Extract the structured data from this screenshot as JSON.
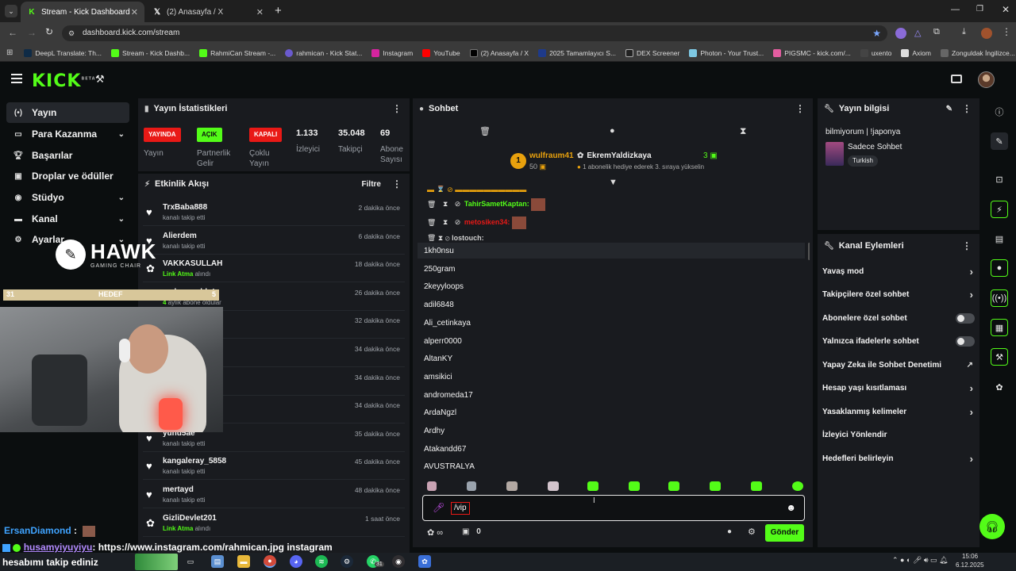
{
  "browser": {
    "tabs": [
      {
        "label": "Stream - Kick Dashboard",
        "active": true
      },
      {
        "label": "(2) Anasayfa / X",
        "active": false
      }
    ],
    "url": "dashboard.kick.com/stream",
    "bookmarks": [
      "DeepL Translate: Th...",
      "Stream - Kick Dashb...",
      "RahmiCan Stream -...",
      "rahmican - Kick Stat...",
      "Instagram",
      "YouTube",
      "(2) Anasayfa / X",
      "2025 Tamamlayıcı S...",
      "DEX Screener",
      "Photon - Your Trust...",
      "PIGSMC - kick.com/...",
      "uxento",
      "Axiom",
      "Zonguldak İngilizce..."
    ]
  },
  "kick": {
    "logo": "KICK",
    "beta": "BETA"
  },
  "sidebar": {
    "items": [
      {
        "label": "Yayın",
        "icon": "broadcast-icon",
        "chev": false
      },
      {
        "label": "Para Kazanma",
        "icon": "money-icon",
        "chev": true
      },
      {
        "label": "Başarılar",
        "icon": "trophy-icon",
        "chev": false
      },
      {
        "label": "Droplar ve ödüller",
        "icon": "gift-icon",
        "chev": false
      },
      {
        "label": "Stüdyo",
        "icon": "studio-icon",
        "chev": true
      },
      {
        "label": "Kanal",
        "icon": "channel-icon",
        "chev": true
      },
      {
        "label": "Ayarlar",
        "icon": "gear-icon",
        "chev": true
      }
    ]
  },
  "stats": {
    "title": "Yayın İstatistikleri",
    "badges": [
      {
        "text": "YAYINDA",
        "label": "Yayın",
        "bg": "#e91916",
        "fg": "#ffffff"
      },
      {
        "text": "AÇIK",
        "label": "Partnerlik Gelir",
        "bg": "#53fc18",
        "fg": "#0b0e0f"
      },
      {
        "text": "KAPALI",
        "label": "Çoklu Yayın",
        "bg": "#e91916",
        "fg": "#ffffff"
      }
    ],
    "numbers": [
      {
        "value": "1.133",
        "label": "İzleyici"
      },
      {
        "value": "35.048",
        "label": "Takipçi"
      },
      {
        "value": "69",
        "label": "Abone Sayısı"
      }
    ]
  },
  "activity": {
    "title": "Etkinlik Akışı",
    "filter": "Filtre",
    "items": [
      {
        "name": "TrxBaba888",
        "sub": "kanalı takip etti",
        "time": "2 dakika önce",
        "type": "follow"
      },
      {
        "name": "Alierdem",
        "sub": "kanalı takip etti",
        "time": "6 dakika önce",
        "type": "follow"
      },
      {
        "name": "VAKKASULLAH",
        "sub_green": "Link Atma",
        "sub": " alındı",
        "time": "18 dakika önce",
        "type": "reward"
      },
      {
        "name": "n abone oldu!",
        "sub_green": "4",
        "sub": " aylık abone oldular",
        "time": "26 dakika önce",
        "type": "sub"
      },
      {
        "name": "",
        "sub": "",
        "time": "32 dakika önce",
        "type": "hidden"
      },
      {
        "name": "",
        "sub": "",
        "time": "34 dakika önce",
        "type": "hidden"
      },
      {
        "name": "",
        "sub": "",
        "time": "34 dakika önce",
        "type": "hidden"
      },
      {
        "name": "",
        "sub": "",
        "time": "34 dakika önce",
        "type": "hidden"
      },
      {
        "name": "yunu5ae",
        "sub": "kanalı takip etti",
        "time": "35 dakika önce",
        "type": "follow"
      },
      {
        "name": "kangaleray_5858",
        "sub": "kanalı takip etti",
        "time": "45 dakika önce",
        "type": "follow"
      },
      {
        "name": "mertayd",
        "sub": "kanalı takip etti",
        "time": "48 dakika önce",
        "type": "follow"
      },
      {
        "name": "GizliDevlet201",
        "sub_green": "Link Atma",
        "sub": " alındı",
        "time": "1 saat önce",
        "type": "reward"
      }
    ]
  },
  "overlay": {
    "brand": "HAWK",
    "brand_sub": "GAMING CHAIR",
    "goal_left": "31",
    "goal_label": "HEDEF",
    "goal_right": "5",
    "chat_line1_user": "ErsanDiamond",
    "chat_line2_user": "husamyiyuyiyu",
    "chat_line2_text": ": https://www.instagram.com/rahmican.jpg instagram",
    "chat_line3": "hesabımı takip ediniz"
  },
  "chat": {
    "title": "Sohbet",
    "pinned_user": "wulfraum41",
    "pinned_count": "50",
    "pinned_rank": "1",
    "gifter": "EkremYaldizkaya",
    "gift_count": "3",
    "gift_text": "1 abonelik hediye ederek 3. sıraya yükselin",
    "messages": [
      {
        "user": "TahirSametKaptan:",
        "color": "#53fc18"
      },
      {
        "user": "metosiken34:",
        "color": "#e91916"
      },
      {
        "user": "lostouch:",
        "color": "#cfcfcf"
      }
    ],
    "suggestions": [
      "1kh0nsu",
      "250gram",
      "2keyyloops",
      "adil6848",
      "Ali_cetinkaya",
      "alperr0000",
      "AltanKY",
      "amsikici",
      "andromeda17",
      "ArdaNgzl",
      "Ardhy",
      "Atakandd67",
      "AVUSTRALYA"
    ],
    "input_value": "/vip",
    "send_label": "Gönder",
    "footer_count": "0"
  },
  "info": {
    "title": "Yayın bilgisi",
    "stream_title": "bilmiyorum | !japonya",
    "category": "Sadece Sohbet",
    "tag": "Turkish"
  },
  "actions": {
    "title": "Kanal Eylemleri",
    "items": [
      {
        "label": "Yavaş mod",
        "ctrl": "arrow"
      },
      {
        "label": "Takipçilere özel sohbet",
        "ctrl": "arrow"
      },
      {
        "label": "Abonelere özel sohbet",
        "ctrl": "toggle"
      },
      {
        "label": "Yalnızca ifadelerle sohbet",
        "ctrl": "toggle"
      },
      {
        "label": "Yapay Zeka ile Sohbet Denetimi",
        "ctrl": "external"
      },
      {
        "label": "Hesap yaşı kısıtlaması",
        "ctrl": "arrow"
      },
      {
        "label": "Yasaklanmış kelimeler",
        "ctrl": "arrow"
      },
      {
        "label": "İzleyici Yönlendir",
        "ctrl": "none"
      },
      {
        "label": "Hedefleri belirleyin",
        "ctrl": "arrow"
      }
    ]
  },
  "taskbar": {
    "time": "15:06",
    "date": "6.12.2025",
    "whatsapp_badge": "31"
  },
  "colors": {
    "accent": "#53fc18",
    "live": "#e91916",
    "panel": "#191b1f",
    "bg": "#0b0e0f"
  }
}
